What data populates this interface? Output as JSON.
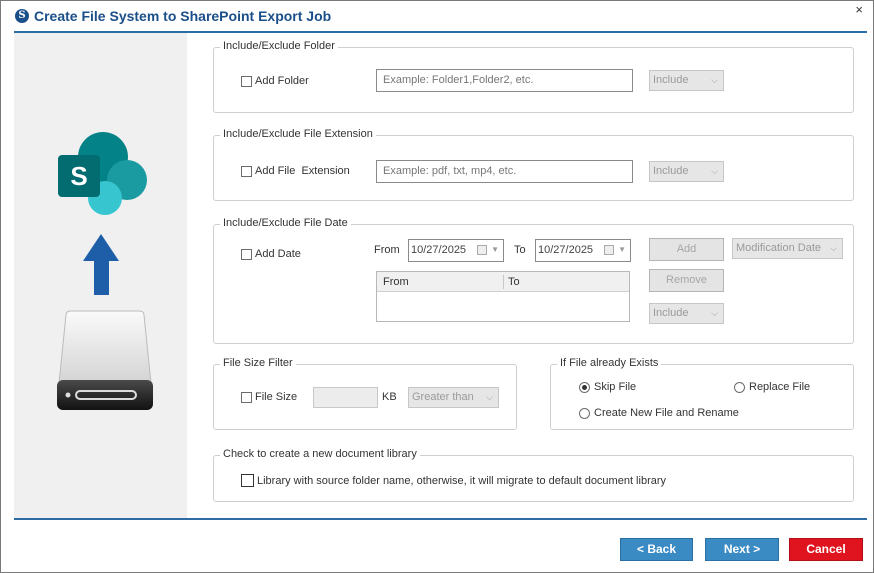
{
  "window": {
    "title": "Create File System to SharePoint Export Job",
    "logo_letter": "S",
    "close_glyph": "×"
  },
  "colors": {
    "title_blue": "#1b4f8a",
    "accent_line": "#2e6da4",
    "button_blue": "#3a8ac4",
    "button_red": "#e0141e",
    "upload_arrow": "#1e5ea8"
  },
  "left_panel": {
    "icons": [
      "sharepoint-logo-icon",
      "upload-arrow-icon",
      "hard-drive-icon"
    ]
  },
  "folder_group": {
    "legend": "Include/Exclude Folder",
    "checkbox_label": "Add Folder",
    "input_placeholder": "Example: Folder1,Folder2, etc.",
    "mode": "Include"
  },
  "extension_group": {
    "legend": "Include/Exclude File Extension",
    "checkbox_label": "Add File  Extension",
    "input_placeholder": "Example: pdf, txt, mp4, etc.",
    "mode": "Include"
  },
  "date_group": {
    "legend": "Include/Exclude File Date",
    "checkbox_label": "Add Date",
    "from_label": "From",
    "from_value": "10/27/2025",
    "to_label": "To",
    "to_value": "10/27/2025",
    "grid_columns": [
      "From",
      "To"
    ],
    "add_button": "Add",
    "remove_button": "Remove",
    "date_type": "Modification Date",
    "mode": "Include"
  },
  "size_group": {
    "legend": "File Size Filter",
    "checkbox_label": "File Size",
    "size_value": "",
    "unit": "KB",
    "comparison": "Greater than"
  },
  "exists_group": {
    "legend": "If File already Exists",
    "options": [
      "Skip File",
      "Replace File",
      "Create New File and Rename"
    ],
    "selected": "Skip File"
  },
  "library_group": {
    "legend": "Check to create a new document library",
    "checkbox_label": "Library with source folder name, otherwise, it will migrate to default document library"
  },
  "footer": {
    "back": "< Back",
    "next": "Next >",
    "cancel": "Cancel"
  }
}
